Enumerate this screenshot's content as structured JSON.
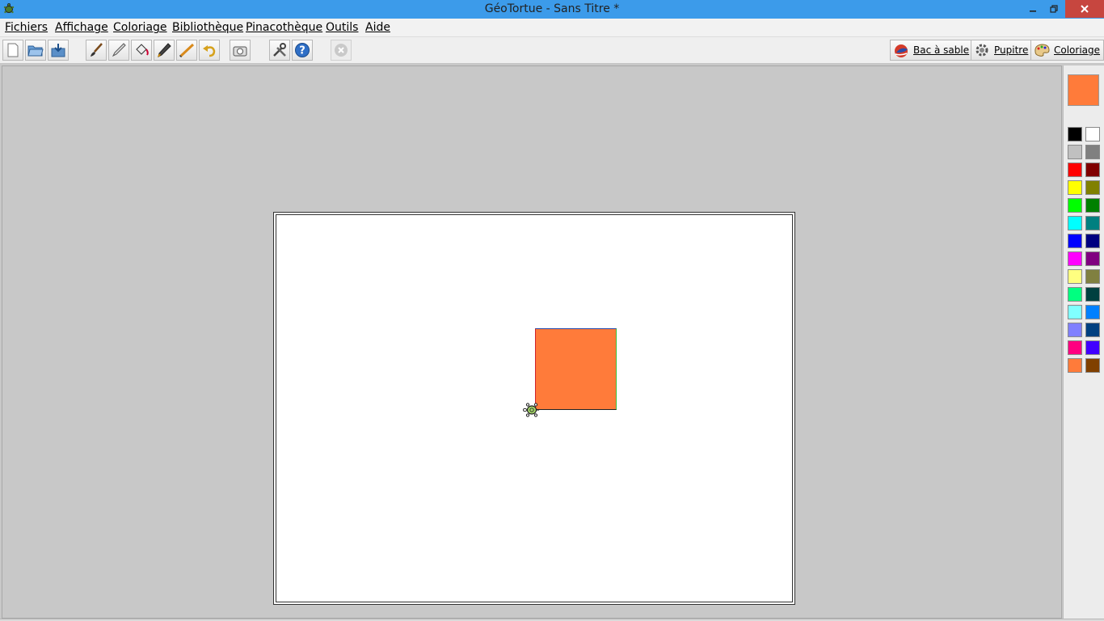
{
  "window": {
    "title": "GéoTortue - Sans Titre *"
  },
  "menu": {
    "items": [
      "Fichiers",
      "Affichage",
      "Coloriage",
      "Bibliothèque",
      "Pinacothèque",
      "Outils",
      "Aide"
    ]
  },
  "toolbar": {
    "tools": [
      {
        "name": "new-file-button",
        "icon": "new-file-icon"
      },
      {
        "name": "open-file-button",
        "icon": "open-folder-icon"
      },
      {
        "name": "save-file-button",
        "icon": "save-icon"
      },
      {
        "name": "brush-tool-button",
        "icon": "brush-icon"
      },
      {
        "name": "pen-tool-button",
        "icon": "pen-icon"
      },
      {
        "name": "fill-tool-button",
        "icon": "paint-bucket-icon"
      },
      {
        "name": "eyedropper-tool-button",
        "icon": "eyedropper-icon"
      },
      {
        "name": "line-tool-button",
        "icon": "pencil-icon"
      },
      {
        "name": "undo-button",
        "icon": "undo-icon"
      },
      {
        "name": "camera-button",
        "icon": "camera-icon"
      },
      {
        "name": "tools-button",
        "icon": "tools-icon"
      },
      {
        "name": "help-button",
        "icon": "help-icon"
      },
      {
        "name": "stop-button",
        "icon": "stop-icon",
        "disabled": true
      }
    ],
    "modes": [
      {
        "name": "sandbox-mode-button",
        "label": "Bac à sable",
        "icon": "sandbox-icon"
      },
      {
        "name": "desk-mode-button",
        "label": "Pupitre",
        "icon": "gear-icon"
      },
      {
        "name": "coloring-mode-button",
        "label": "Coloriage",
        "icon": "palette-icon"
      }
    ]
  },
  "canvas": {
    "square_color": "#ff7b3a"
  },
  "palette": {
    "current_color": "#ff7b3a",
    "colors": [
      [
        "#000000",
        "#ffffff"
      ],
      [
        "#c0c0c0",
        "#808080"
      ],
      [
        "#ff0000",
        "#800000"
      ],
      [
        "#ffff00",
        "#808000"
      ],
      [
        "#00ff00",
        "#008000"
      ],
      [
        "#00ffff",
        "#008080"
      ],
      [
        "#0000ff",
        "#000080"
      ],
      [
        "#ff00ff",
        "#800080"
      ],
      [
        "#ffff80",
        "#808040"
      ],
      [
        "#00ff80",
        "#004040"
      ],
      [
        "#80ffff",
        "#0080ff"
      ],
      [
        "#8080ff",
        "#004080"
      ],
      [
        "#ff0080",
        "#4000ff"
      ],
      [
        "#ff7b3a",
        "#804000"
      ]
    ]
  }
}
